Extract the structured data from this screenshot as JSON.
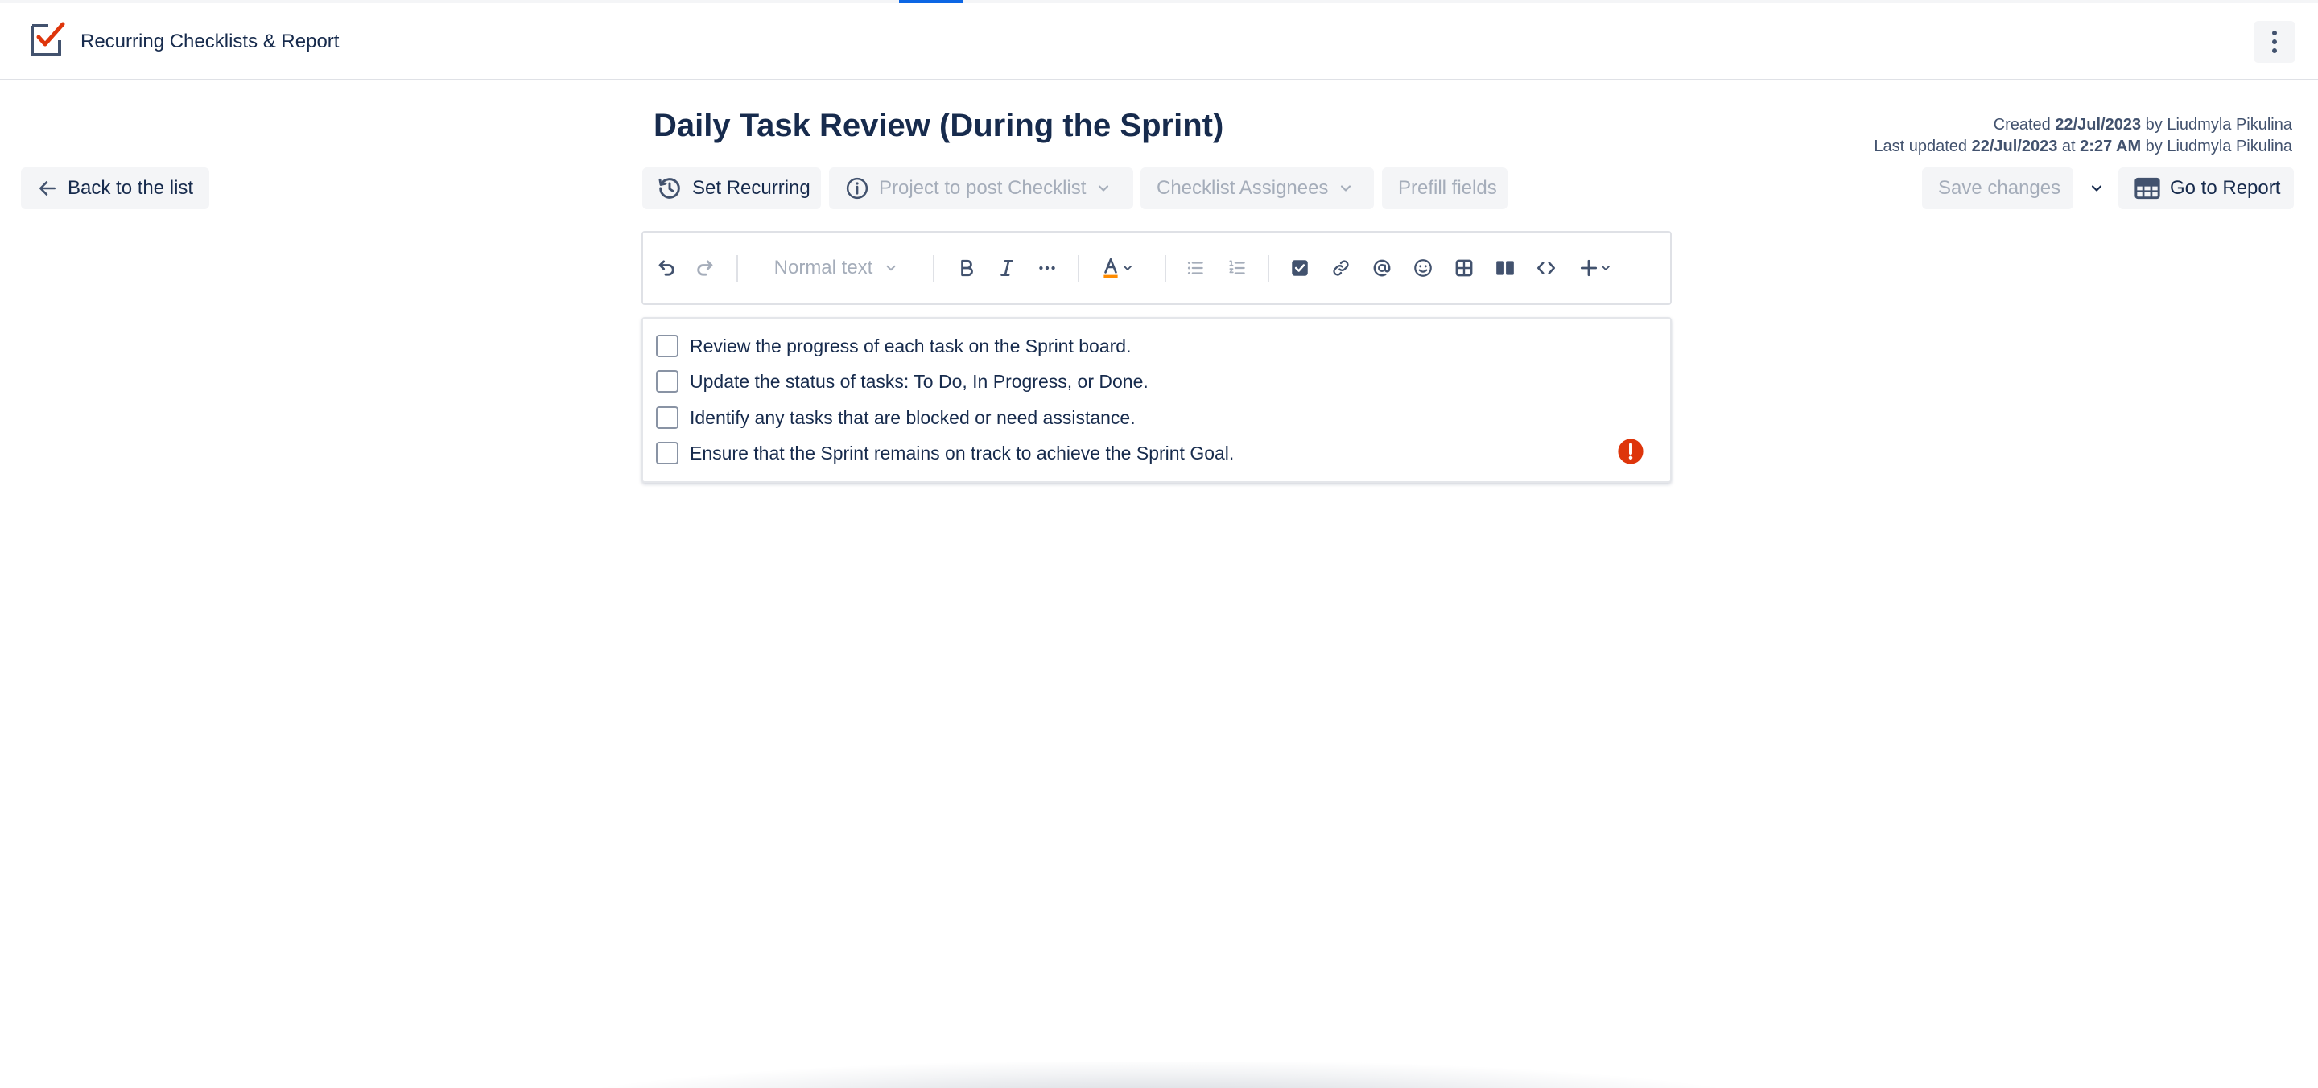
{
  "app": {
    "name": "Recurring Checklists & Report",
    "logo_icon": "checklist-logo-icon",
    "accent_color": "#0c66e4",
    "logo_check_color": "#de350b"
  },
  "page": {
    "title": "Daily Task Review (During the Sprint)",
    "created_prefix": "Created",
    "created_date": "22/Jul/2023",
    "created_by_prefix": "by",
    "created_by": "Liudmyla Pikulina",
    "updated_prefix": "Last updated",
    "updated_date": "22/Jul/2023",
    "updated_at_prefix": "at",
    "updated_time": "2:27 AM",
    "updated_by_prefix": "by",
    "updated_by": "Liudmyla Pikulina"
  },
  "actions": {
    "back_label": "Back to the list",
    "set_recurring_label": "Set Recurring",
    "project_label": "Project to post Checklist",
    "assignees_label": "Checklist Assignees",
    "prefill_label": "Prefill fields",
    "save_label": "Save changes",
    "report_label": "Go to Report"
  },
  "toolbar": {
    "text_style": "Normal text"
  },
  "tasks": [
    {
      "text": "Review the progress of each task on the Sprint board.",
      "checked": false
    },
    {
      "text": "Update the status of tasks: To Do, In Progress, or Done.",
      "checked": false
    },
    {
      "text": "Identify any tasks that are blocked or need assistance.",
      "checked": false
    },
    {
      "text": "Ensure that the Sprint remains on track to achieve the Sprint Goal.",
      "checked": false
    }
  ],
  "status": {
    "error_color": "#de350b"
  }
}
